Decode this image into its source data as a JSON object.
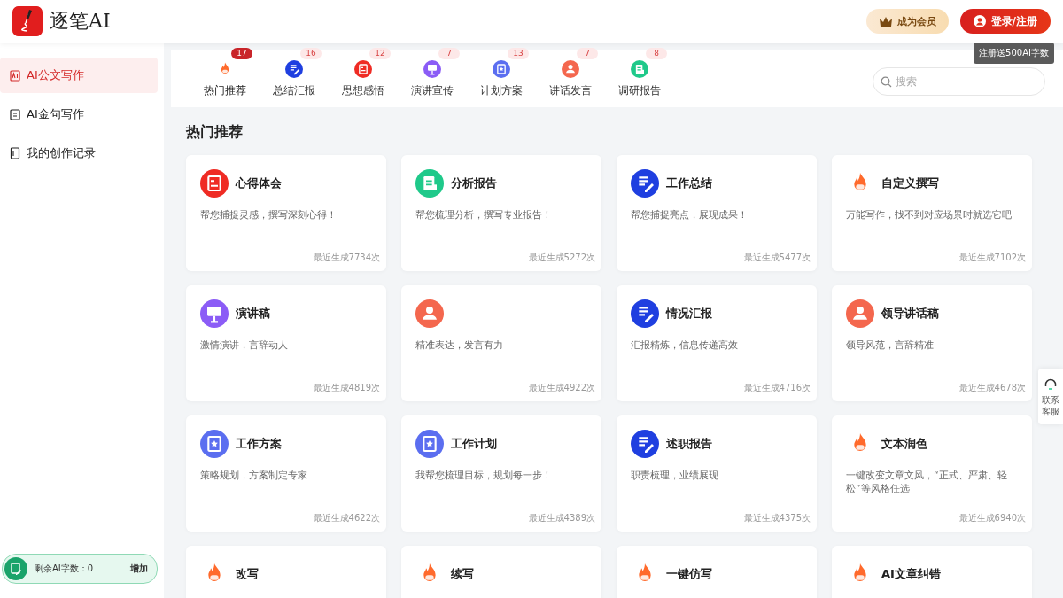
{
  "header": {
    "logo_text": "逐笔AI",
    "member_button": "成为会员",
    "login_button": "登录/注册",
    "login_tooltip": "注册送500AI字数"
  },
  "sidebar": {
    "items": [
      {
        "label": "AI公文写作",
        "selected": true
      },
      {
        "label": "AI金句写作",
        "selected": false
      },
      {
        "label": "我的创作记录",
        "selected": false
      }
    ],
    "credits": {
      "label": "剩余AI字数：0",
      "action": "增加"
    }
  },
  "categories": [
    {
      "label": "热门推荐",
      "count": "17",
      "kind": "fire",
      "selected": true
    },
    {
      "label": "总结汇报",
      "count": "16",
      "kind": "pen",
      "selected": false
    },
    {
      "label": "思想感悟",
      "count": "12",
      "kind": "heart",
      "selected": false
    },
    {
      "label": "演讲宣传",
      "count": "7",
      "kind": "easel",
      "selected": false
    },
    {
      "label": "计划方案",
      "count": "13",
      "kind": "plan",
      "selected": false
    },
    {
      "label": "讲话发言",
      "count": "7",
      "kind": "speaker",
      "selected": false
    },
    {
      "label": "调研报告",
      "count": "8",
      "kind": "report",
      "selected": false
    }
  ],
  "search": {
    "placeholder": "搜索"
  },
  "section_title": "热门推荐",
  "cards": [
    {
      "title": "心得体会",
      "description": "帮您捕捉灵感，撰写深刻心得！",
      "usage": "最近生成7734次",
      "kind": "heart"
    },
    {
      "title": "分析报告",
      "description": "帮您梳理分析，撰写专业报告！",
      "usage": "最近生成5272次",
      "kind": "report"
    },
    {
      "title": "工作总结",
      "description": "帮您捕捉亮点，展现成果！",
      "usage": "最近生成5477次",
      "kind": "pen"
    },
    {
      "title": "自定义撰写",
      "description": "万能写作，找不到对应场景时就选它吧",
      "usage": "最近生成7102次",
      "kind": "fire"
    },
    {
      "title": "演讲稿",
      "description": "激情演讲，言辞动人",
      "usage": "最近生成4819次",
      "kind": "easel"
    },
    {
      "description": "精准表达，发言有力",
      "usage": "最近生成4922次",
      "kind": "speaker"
    },
    {
      "title": "情况汇报",
      "description": "汇报精炼，信息传递高效",
      "usage": "最近生成4716次",
      "kind": "pen"
    },
    {
      "title": "领导讲话稿",
      "description": "领导风范，言辞精准",
      "usage": "最近生成4678次",
      "kind": "speaker"
    },
    {
      "title": "工作方案",
      "description": "策略规划，方案制定专家",
      "usage": "最近生成4622次",
      "kind": "plan"
    },
    {
      "title": "工作计划",
      "description": "我帮您梳理目标，规划每一步！",
      "usage": "最近生成4389次",
      "kind": "plan"
    },
    {
      "title": "述职报告",
      "description": "职责梳理，业绩展现",
      "usage": "最近生成4375次",
      "kind": "pen"
    },
    {
      "title": "文本润色",
      "description": "一键改变文章文风，“正式、严肃、轻松”等风格任选",
      "usage": "最近生成6940次",
      "kind": "fire"
    },
    {
      "title": "改写",
      "kind": "fire"
    },
    {
      "title": "续写",
      "kind": "fire"
    },
    {
      "title": "一键仿写",
      "kind": "fire"
    },
    {
      "title": "AI文章纠错",
      "kind": "fire"
    }
  ],
  "contact": {
    "label": "联系客服"
  }
}
